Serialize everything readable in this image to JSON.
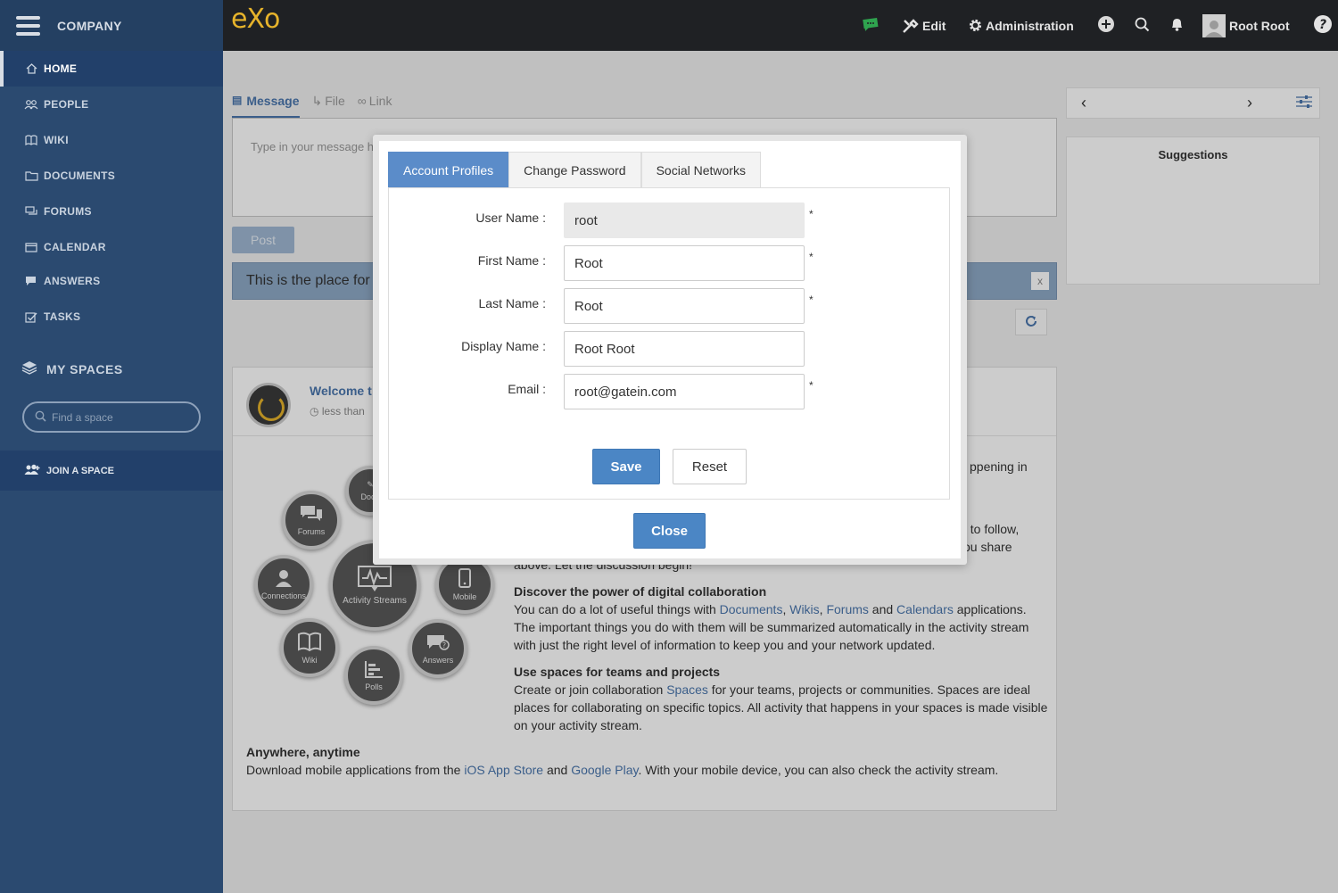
{
  "sidebar": {
    "company": "COMPANY",
    "nav": [
      {
        "label": "HOME",
        "icon": "home-icon"
      },
      {
        "label": "PEOPLE",
        "icon": "people-icon"
      },
      {
        "label": "WIKI",
        "icon": "wiki-icon"
      },
      {
        "label": "DOCUMENTS",
        "icon": "folder-icon"
      },
      {
        "label": "FORUMS",
        "icon": "forums-icon"
      },
      {
        "label": "CALENDAR",
        "icon": "calendar-icon"
      },
      {
        "label": "ANSWERS",
        "icon": "answers-icon"
      },
      {
        "label": "TASKS",
        "icon": "tasks-icon"
      }
    ],
    "my_spaces": "MY SPACES",
    "find_space_placeholder": "Find a space",
    "join_space": "JOIN A SPACE"
  },
  "topbar": {
    "logo_e": "e",
    "logo_x": "X",
    "logo_o": "o",
    "edit": "Edit",
    "administration": "Administration",
    "user": "Root Root"
  },
  "composer": {
    "tabs": [
      "Message",
      "File",
      "Link"
    ],
    "placeholder": "Type in your message h",
    "post": "Post",
    "info": "This is the place for s",
    "info_close": "x"
  },
  "welcome": {
    "title": "Welcome t",
    "time": "less than",
    "bubbles": {
      "documents": "Docu",
      "forums": "Forums",
      "connections": "Connections",
      "activity": "Activity Streams",
      "mobile": "Mobile",
      "wiki": "Wiki",
      "polls": "Polls",
      "answers": "Answers"
    },
    "frag1": "ppening in",
    "frag2a": "le to follow,",
    "frag2b": "you share",
    "frag3": "above. Let the discussion begin!",
    "discover": {
      "heading": "Discover the power of digital collaboration",
      "t1": "You can do a lot of useful things with ",
      "l1": "Documents",
      "s1": ", ",
      "l2": "Wikis",
      "s2": ", ",
      "l3": "Forums",
      "s3": " and ",
      "l4": "Calendars",
      "t2": " applications. The important things you do with them will be summarized automatically in the activity stream with just the right level of information to keep you and your network updated."
    },
    "spaces": {
      "heading": "Use spaces for teams and projects",
      "t1": "Create or join collaboration ",
      "l1": "Spaces",
      "t2": " for your teams, projects or communities. Spaces are ideal places for collaborating on specific topics. All activity that happens in your spaces is made visible on your activity stream."
    },
    "anywhere": {
      "heading": "Anywhere, anytime",
      "t1": "Download mobile applications from the ",
      "l1": "iOS App Store",
      "t2": " and ",
      "l2": "Google Play",
      "t3": ". With your mobile device, you can also check the activity stream."
    }
  },
  "right": {
    "prev": "‹",
    "next": "›",
    "suggestions": "Suggestions"
  },
  "modal": {
    "tabs": [
      "Account Profiles",
      "Change Password",
      "Social Networks"
    ],
    "fields": [
      {
        "label": "User Name :",
        "value": "root",
        "required": "*"
      },
      {
        "label": "First Name :",
        "value": "Root",
        "required": "*"
      },
      {
        "label": "Last Name :",
        "value": "Root",
        "required": "*"
      },
      {
        "label": "Display Name :",
        "value": "Root Root",
        "required": ""
      },
      {
        "label": "Email :",
        "value": "root@gatein.com",
        "required": "*"
      }
    ],
    "save": "Save",
    "reset": "Reset",
    "close": "Close"
  },
  "colors": {
    "sidebar": "#2b4a70",
    "topbar": "#1f2124",
    "accent": "#4b86c5",
    "logo": "#e6b32b"
  }
}
